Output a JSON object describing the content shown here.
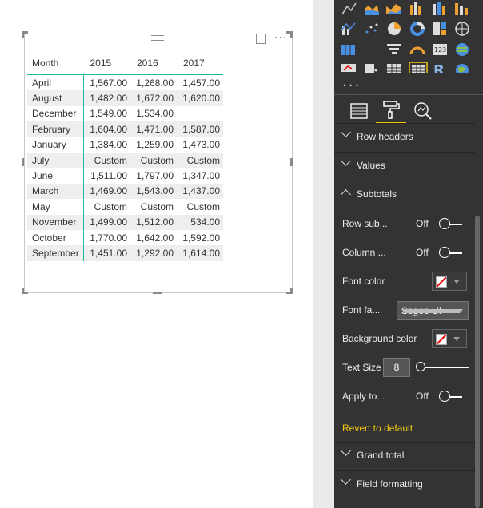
{
  "visual": {
    "header": {
      "month": "Month",
      "years": [
        "2015",
        "2016",
        "2017"
      ]
    },
    "rows": [
      {
        "month": "April",
        "v": [
          "1,567.00",
          "1,268.00",
          "1,457.00"
        ]
      },
      {
        "month": "August",
        "v": [
          "1,482.00",
          "1,672.00",
          "1,620.00"
        ]
      },
      {
        "month": "December",
        "v": [
          "1,549.00",
          "1,534.00",
          ""
        ]
      },
      {
        "month": "February",
        "v": [
          "1,604.00",
          "1,471.00",
          "1,587.00"
        ]
      },
      {
        "month": "January",
        "v": [
          "1,384.00",
          "1,259.00",
          "1,473.00"
        ]
      },
      {
        "month": "July",
        "v": [
          "Custom",
          "Custom",
          "Custom"
        ]
      },
      {
        "month": "June",
        "v": [
          "1,511.00",
          "1,797.00",
          "1,347.00"
        ]
      },
      {
        "month": "March",
        "v": [
          "1,469.00",
          "1,543.00",
          "1,437.00"
        ]
      },
      {
        "month": "May",
        "v": [
          "Custom",
          "Custom",
          "Custom"
        ]
      },
      {
        "month": "November",
        "v": [
          "1,499.00",
          "1,512.00",
          "534.00"
        ]
      },
      {
        "month": "October",
        "v": [
          "1,770.00",
          "1,642.00",
          "1,592.00"
        ]
      },
      {
        "month": "September",
        "v": [
          "1,451.00",
          "1,292.00",
          "1,614.00"
        ]
      }
    ],
    "icons": {
      "focus": "focus-mode-icon",
      "more": "more-options-icon",
      "grip": "drag-grip-icon"
    }
  },
  "pane": {
    "tabs": [
      "fields-icon",
      "format-paintroller-icon",
      "analytics-icon"
    ],
    "sections": {
      "row_headers": "Row headers",
      "values": "Values",
      "subtotals": "Subtotals",
      "grand_total": "Grand total",
      "field_formatting": "Field formatting"
    },
    "subtotals": {
      "row_sub_label": "Row sub...",
      "row_sub_state": "Off",
      "column_label": "Column ...",
      "column_state": "Off",
      "font_color_label": "Font color",
      "font_family_label": "Font fa...",
      "font_family_value": "Segoe UI",
      "bg_color_label": "Background color",
      "text_size_label": "Text Size",
      "text_size_value": "8",
      "apply_to_label": "Apply to...",
      "apply_to_state": "Off",
      "revert": "Revert to default"
    },
    "more": "..."
  },
  "colors": {
    "accent": "#f2c811",
    "teal": "#1abc9c",
    "pane_bg": "#333333"
  }
}
